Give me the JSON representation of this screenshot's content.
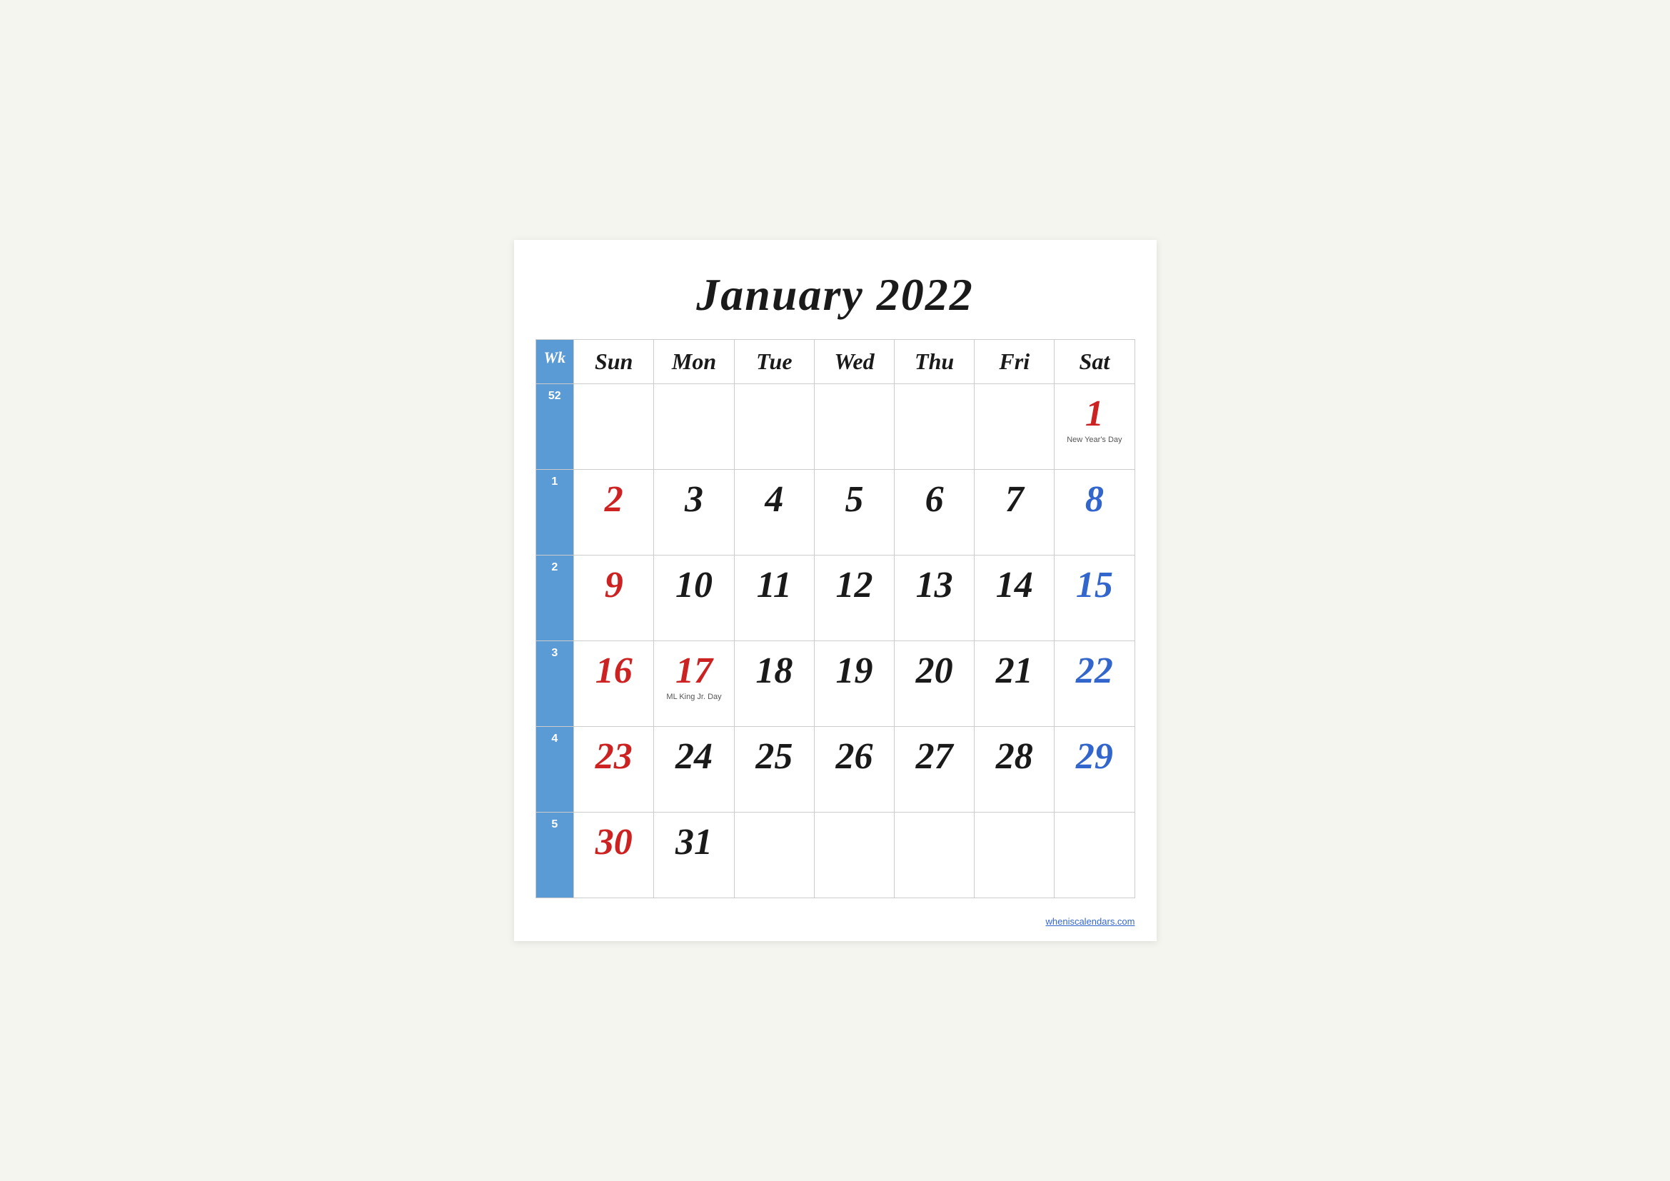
{
  "title": "January 2022",
  "header": {
    "wk": "Wk",
    "days": [
      "Sun",
      "Mon",
      "Tue",
      "Wed",
      "Thu",
      "Fri",
      "Sat"
    ]
  },
  "weeks": [
    {
      "wk": "52",
      "days": [
        {
          "date": "",
          "color": ""
        },
        {
          "date": "",
          "color": ""
        },
        {
          "date": "",
          "color": ""
        },
        {
          "date": "",
          "color": ""
        },
        {
          "date": "",
          "color": ""
        },
        {
          "date": "",
          "color": ""
        },
        {
          "date": "1",
          "color": "red",
          "holiday": "New Year's Day"
        }
      ]
    },
    {
      "wk": "1",
      "days": [
        {
          "date": "2",
          "color": "red"
        },
        {
          "date": "3",
          "color": "black"
        },
        {
          "date": "4",
          "color": "black"
        },
        {
          "date": "5",
          "color": "black"
        },
        {
          "date": "6",
          "color": "black"
        },
        {
          "date": "7",
          "color": "black"
        },
        {
          "date": "8",
          "color": "blue"
        }
      ]
    },
    {
      "wk": "2",
      "days": [
        {
          "date": "9",
          "color": "red"
        },
        {
          "date": "10",
          "color": "black"
        },
        {
          "date": "11",
          "color": "black"
        },
        {
          "date": "12",
          "color": "black"
        },
        {
          "date": "13",
          "color": "black"
        },
        {
          "date": "14",
          "color": "black"
        },
        {
          "date": "15",
          "color": "blue"
        }
      ]
    },
    {
      "wk": "3",
      "days": [
        {
          "date": "16",
          "color": "red"
        },
        {
          "date": "17",
          "color": "red",
          "holiday": "ML King Jr. Day"
        },
        {
          "date": "18",
          "color": "black"
        },
        {
          "date": "19",
          "color": "black"
        },
        {
          "date": "20",
          "color": "black"
        },
        {
          "date": "21",
          "color": "black"
        },
        {
          "date": "22",
          "color": "blue"
        }
      ]
    },
    {
      "wk": "4",
      "days": [
        {
          "date": "23",
          "color": "red"
        },
        {
          "date": "24",
          "color": "black"
        },
        {
          "date": "25",
          "color": "black"
        },
        {
          "date": "26",
          "color": "black"
        },
        {
          "date": "27",
          "color": "black"
        },
        {
          "date": "28",
          "color": "black"
        },
        {
          "date": "29",
          "color": "blue"
        }
      ]
    },
    {
      "wk": "5",
      "days": [
        {
          "date": "30",
          "color": "red"
        },
        {
          "date": "31",
          "color": "black"
        },
        {
          "date": "",
          "color": ""
        },
        {
          "date": "",
          "color": ""
        },
        {
          "date": "",
          "color": ""
        },
        {
          "date": "",
          "color": ""
        },
        {
          "date": "",
          "color": ""
        }
      ]
    }
  ],
  "watermark": "wheniscalendars.com"
}
